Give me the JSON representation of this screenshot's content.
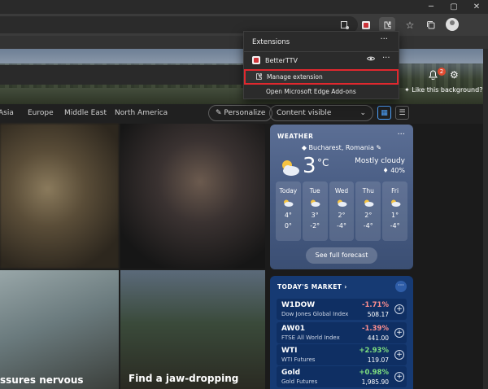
{
  "window": {
    "controls": {
      "minimize": "─",
      "maximize": "▢",
      "close": "✕"
    }
  },
  "toolbar": {
    "icons": [
      "tracking-icon",
      "bttv-icon",
      "extensions-icon",
      "favorites-icon",
      "collections-icon",
      "profile-avatar"
    ]
  },
  "extensions_popup": {
    "title": "Extensions",
    "more": "···",
    "items": [
      {
        "name": "BetterTTV",
        "visible_icon": "eye-icon",
        "more": "···"
      }
    ],
    "manage_label": "Manage extension",
    "addons_label": "Open Microsoft Edge Add-ons",
    "highlight_color": "#e0282e"
  },
  "hero": {
    "notification_count": "2",
    "like_background": "Like this background?"
  },
  "nav": {
    "categories": [
      "Asia",
      "Europe",
      "Middle East",
      "North America"
    ],
    "personalize": "Personalize",
    "content_visibility": "Content visible"
  },
  "news": {
    "headline_left": "ssures nervous",
    "headline_right": "Find a jaw-dropping"
  },
  "weather": {
    "label": "WEATHER",
    "location": "Bucharest, Romania",
    "temperature": "3",
    "unit": "°C",
    "condition": "Mostly cloudy",
    "precipitation": "40%",
    "forecast_button": "See full forecast",
    "days": [
      {
        "name": "Today",
        "high": "4°",
        "low": "0°"
      },
      {
        "name": "Tue",
        "high": "3°",
        "low": "-2°"
      },
      {
        "name": "Wed",
        "high": "2°",
        "low": "-4°"
      },
      {
        "name": "Thu",
        "high": "2°",
        "low": "-4°"
      },
      {
        "name": "Fri",
        "high": "1°",
        "low": "-4°"
      }
    ]
  },
  "market": {
    "title": "TODAY'S MARKET",
    "more": "···",
    "rows": [
      {
        "symbol": "W1DOW",
        "name": "Dow Jones Global Index",
        "change": "-1.71%",
        "price": "508.17",
        "direction": "down"
      },
      {
        "symbol": "AW01",
        "name": "FTSE All World Index",
        "change": "-1.39%",
        "price": "441.00",
        "direction": "down"
      },
      {
        "symbol": "WTI",
        "name": "WTI Futures",
        "change": "+2.93%",
        "price": "119.07",
        "direction": "up"
      },
      {
        "symbol": "Gold",
        "name": "Gold Futures",
        "change": "+0.98%",
        "price": "1,985.90",
        "direction": "up"
      }
    ]
  }
}
